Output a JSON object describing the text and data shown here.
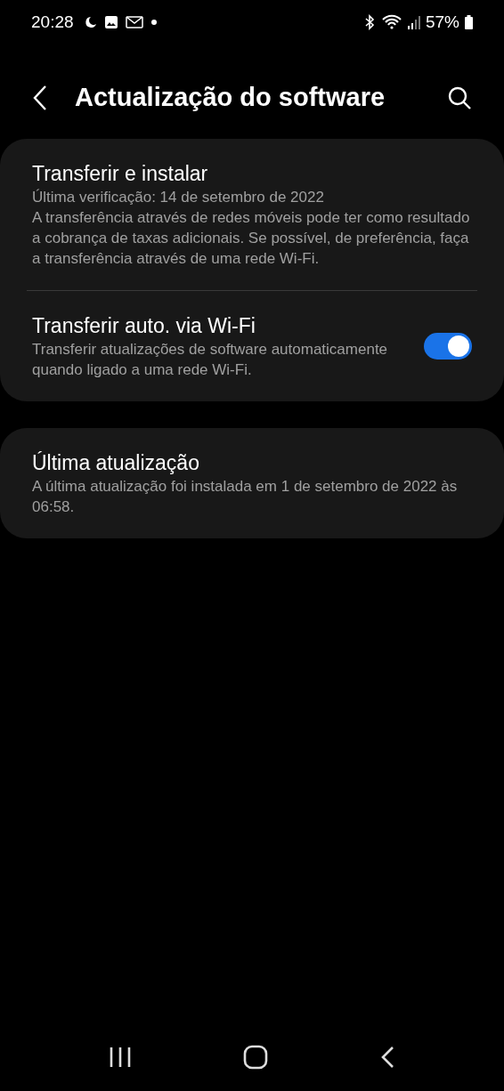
{
  "status_bar": {
    "time": "20:28",
    "battery": "57%"
  },
  "header": {
    "title": "Actualização do software"
  },
  "cards": [
    {
      "items": [
        {
          "kind": "plain",
          "title": "Transferir e instalar",
          "lines": [
            "Última verificação: 14 de setembro de 2022",
            "A transferência através de redes móveis pode ter como resultado a cobrança de taxas adicionais. Se possível, de preferência, faça a transferência através de uma rede Wi-Fi."
          ]
        },
        {
          "kind": "toggle",
          "title": "Transferir auto. via Wi-Fi",
          "lines": [
            "Transferir atualizações de software automaticamente quando ligado a uma rede Wi-Fi."
          ],
          "on": true
        }
      ]
    },
    {
      "items": [
        {
          "kind": "plain",
          "title": "Última atualização",
          "lines": [
            "A última atualização foi instalada em 1 de setembro de 2022 às 06:58."
          ]
        }
      ]
    }
  ]
}
